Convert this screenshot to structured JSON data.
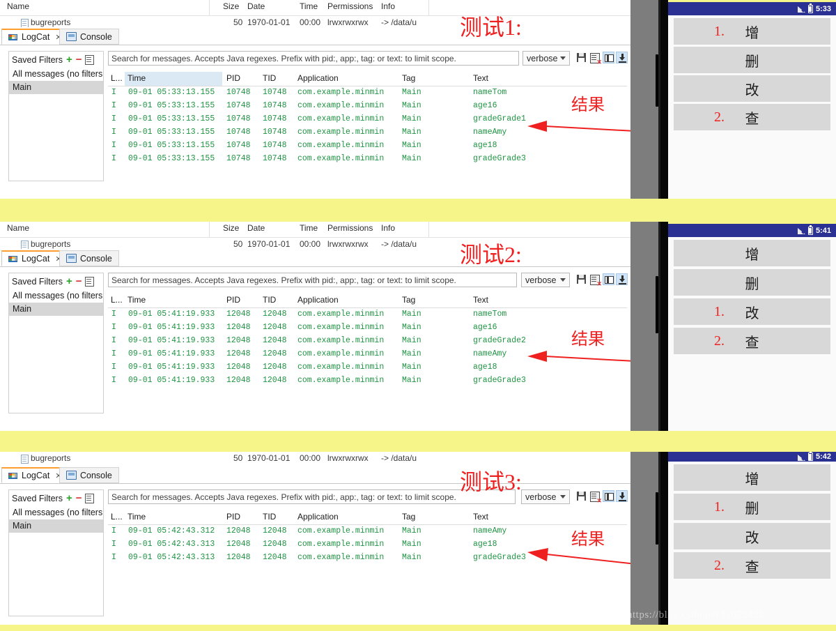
{
  "background_color": "#f5f58a",
  "file_explorer": {
    "columns": [
      "Name",
      "Size",
      "Date",
      "Time",
      "Permissions",
      "Info"
    ],
    "row": {
      "name": "bugreports",
      "size": "50",
      "date": "1970-01-01",
      "time": "00:00",
      "permissions": "lrwxrwxrwx",
      "info": "-> /data/u"
    }
  },
  "logcat": {
    "tabs": [
      {
        "label": "LogCat",
        "icon": "logcat-icon",
        "close": "✕",
        "active": true
      },
      {
        "label": "Console",
        "icon": "console-icon",
        "active": false
      }
    ],
    "filters": {
      "title": "Saved Filters",
      "add_icon": "+",
      "remove_icon": "−",
      "edit_icon": "edit-icon",
      "items": [
        {
          "label": "All messages (no filters",
          "selected": false
        },
        {
          "label": "Main",
          "selected": true
        }
      ]
    },
    "search_placeholder": "Search for messages. Accepts Java regexes. Prefix with pid:, app:, tag: or text: to limit scope.",
    "level": "verbose",
    "toolbar_icons": [
      "save-icon",
      "clear-log-icon",
      "display-saved-filters-icon",
      "scroll-lock-icon"
    ],
    "columns": [
      "L...",
      "Time",
      "PID",
      "TID",
      "Application",
      "Tag",
      "Text"
    ]
  },
  "panels": [
    {
      "annotation_title": "测试1:",
      "annotation_result": "结果",
      "phone_time": "5:33",
      "rows": [
        {
          "level": "I",
          "time": "09-01 05:33:13.155",
          "pid": "10748",
          "tid": "10748",
          "app": "com.example.minmin",
          "tag": "Main",
          "text": "nameTom"
        },
        {
          "level": "I",
          "time": "09-01 05:33:13.155",
          "pid": "10748",
          "tid": "10748",
          "app": "com.example.minmin",
          "tag": "Main",
          "text": "age16"
        },
        {
          "level": "I",
          "time": "09-01 05:33:13.155",
          "pid": "10748",
          "tid": "10748",
          "app": "com.example.minmin",
          "tag": "Main",
          "text": "gradeGrade1"
        },
        {
          "level": "I",
          "time": "09-01 05:33:13.155",
          "pid": "10748",
          "tid": "10748",
          "app": "com.example.minmin",
          "tag": "Main",
          "text": "nameAmy"
        },
        {
          "level": "I",
          "time": "09-01 05:33:13.155",
          "pid": "10748",
          "tid": "10748",
          "app": "com.example.minmin",
          "tag": "Main",
          "text": "age18"
        },
        {
          "level": "I",
          "time": "09-01 05:33:13.155",
          "pid": "10748",
          "tid": "10748",
          "app": "com.example.minmin",
          "tag": "Main",
          "text": "gradeGrade3"
        }
      ],
      "phone_buttons": [
        {
          "num": "1.",
          "label": "增"
        },
        {
          "num": "",
          "label": "删"
        },
        {
          "num": "",
          "label": "改"
        },
        {
          "num": "2.",
          "label": "查"
        }
      ]
    },
    {
      "annotation_title": "测试2:",
      "annotation_result": "结果",
      "phone_time": "5:41",
      "rows": [
        {
          "level": "I",
          "time": "09-01 05:41:19.933",
          "pid": "12048",
          "tid": "12048",
          "app": "com.example.minmin",
          "tag": "Main",
          "text": "nameTom"
        },
        {
          "level": "I",
          "time": "09-01 05:41:19.933",
          "pid": "12048",
          "tid": "12048",
          "app": "com.example.minmin",
          "tag": "Main",
          "text": "age16"
        },
        {
          "level": "I",
          "time": "09-01 05:41:19.933",
          "pid": "12048",
          "tid": "12048",
          "app": "com.example.minmin",
          "tag": "Main",
          "text": "gradeGrade2"
        },
        {
          "level": "I",
          "time": "09-01 05:41:19.933",
          "pid": "12048",
          "tid": "12048",
          "app": "com.example.minmin",
          "tag": "Main",
          "text": "nameAmy"
        },
        {
          "level": "I",
          "time": "09-01 05:41:19.933",
          "pid": "12048",
          "tid": "12048",
          "app": "com.example.minmin",
          "tag": "Main",
          "text": "age18"
        },
        {
          "level": "I",
          "time": "09-01 05:41:19.933",
          "pid": "12048",
          "tid": "12048",
          "app": "com.example.minmin",
          "tag": "Main",
          "text": "gradeGrade3"
        }
      ],
      "phone_buttons": [
        {
          "num": "",
          "label": "增"
        },
        {
          "num": "",
          "label": "删"
        },
        {
          "num": "1.",
          "label": "改"
        },
        {
          "num": "2.",
          "label": "查"
        }
      ]
    },
    {
      "annotation_title": "测试3:",
      "annotation_result": "结果",
      "phone_time": "5:42",
      "rows": [
        {
          "level": "I",
          "time": "09-01 05:42:43.312",
          "pid": "12048",
          "tid": "12048",
          "app": "com.example.minmin",
          "tag": "Main",
          "text": "nameAmy"
        },
        {
          "level": "I",
          "time": "09-01 05:42:43.313",
          "pid": "12048",
          "tid": "12048",
          "app": "com.example.minmin",
          "tag": "Main",
          "text": "age18"
        },
        {
          "level": "I",
          "time": "09-01 05:42:43.313",
          "pid": "12048",
          "tid": "12048",
          "app": "com.example.minmin",
          "tag": "Main",
          "text": "gradeGrade3"
        }
      ],
      "phone_buttons": [
        {
          "num": "",
          "label": "增"
        },
        {
          "num": "1.",
          "label": "删"
        },
        {
          "num": "",
          "label": "改"
        },
        {
          "num": "2.",
          "label": "查"
        }
      ]
    }
  ],
  "watermark": "https://blog.csdn.net/ly07242k"
}
